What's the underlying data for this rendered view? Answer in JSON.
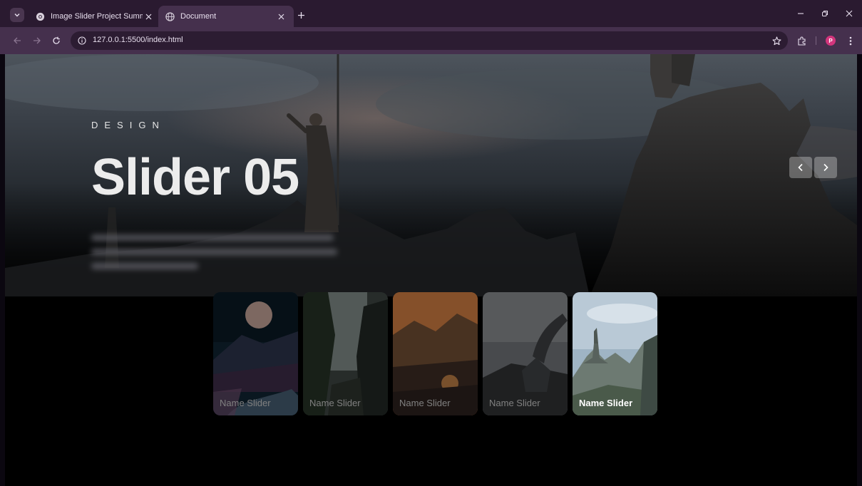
{
  "browser": {
    "tabs": [
      {
        "title": "Image Slider Project Summary",
        "active": false
      },
      {
        "title": "Document",
        "active": true
      }
    ],
    "url": "127.0.0.1:5500/index.html",
    "profile_initial": "P"
  },
  "slider": {
    "author": "DESIGN",
    "title": "Slider 05",
    "thumbnails": [
      {
        "name": "Name Slider"
      },
      {
        "name": "Name Slider"
      },
      {
        "name": "Name Slider"
      },
      {
        "name": "Name Slider"
      },
      {
        "name": "Name Slider"
      }
    ]
  },
  "colors": {
    "chrome_tabbar": "#2a1a30",
    "chrome_toolbar": "#45304d",
    "page_background": "#000000",
    "profile_badge": "#d2357c"
  },
  "icons": [
    "tab-search-icon",
    "chrome-icon",
    "globe-icon",
    "close-icon",
    "plus-icon",
    "minimize-icon",
    "restore-icon",
    "back-icon",
    "forward-icon",
    "reload-icon",
    "info-icon",
    "star-icon",
    "extensions-icon",
    "more-icon",
    "chevron-left-icon",
    "chevron-right-icon"
  ]
}
